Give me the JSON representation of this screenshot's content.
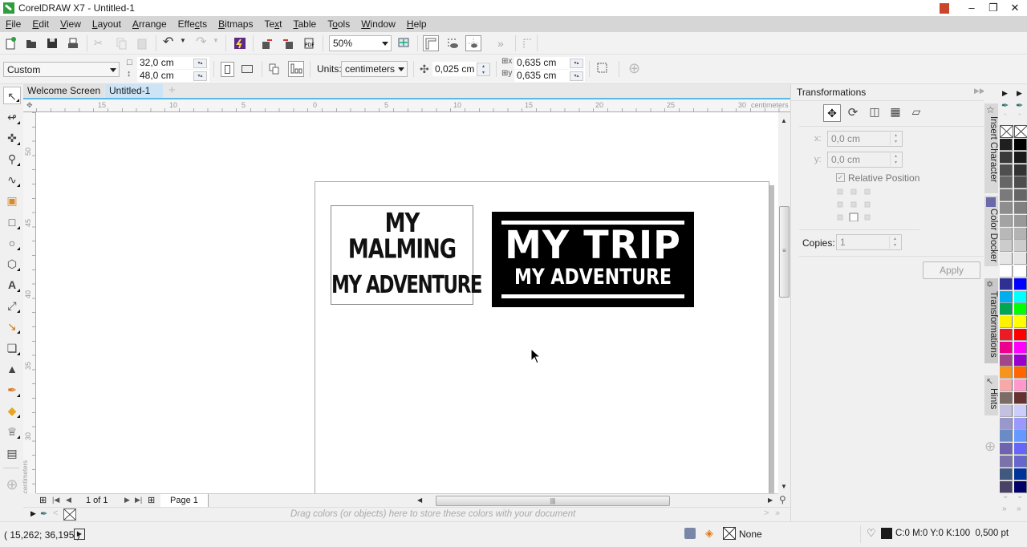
{
  "app": {
    "title": "CorelDRAW X7 - Untitled-1",
    "window_controls": [
      "minimize",
      "restore",
      "close"
    ]
  },
  "menu": [
    {
      "label": "File",
      "mnemonic_index": 0
    },
    {
      "label": "Edit",
      "mnemonic_index": 0
    },
    {
      "label": "View",
      "mnemonic_index": 0
    },
    {
      "label": "Layout",
      "mnemonic_index": 0
    },
    {
      "label": "Arrange",
      "mnemonic_index": 0
    },
    {
      "label": "Effects",
      "mnemonic_index": 4
    },
    {
      "label": "Bitmaps",
      "mnemonic_index": 0
    },
    {
      "label": "Text",
      "mnemonic_index": 2
    },
    {
      "label": "Table",
      "mnemonic_index": 0
    },
    {
      "label": "Tools",
      "mnemonic_index": 1
    },
    {
      "label": "Window",
      "mnemonic_index": 0
    },
    {
      "label": "Help",
      "mnemonic_index": 0
    }
  ],
  "toolbar": {
    "zoom_level": "50%",
    "icons": [
      "new-document",
      "open",
      "save",
      "print",
      "cut",
      "copy",
      "paste",
      "undo",
      "redo",
      "corel-connect",
      "import",
      "export",
      "export-pdf",
      "full-screen-preview",
      "show-rulers",
      "view-grid",
      "snap-to",
      "more",
      "guidelines"
    ]
  },
  "property_bar": {
    "page_size": "Custom",
    "width": "32,0 cm",
    "height": "48,0 cm",
    "units_label": "Units:",
    "units": "centimeters",
    "nudge": "0,025 cm",
    "dup_x": "0,635 cm",
    "dup_y": "0,635 cm"
  },
  "tabs": [
    {
      "label": "Welcome Screen",
      "active": false
    },
    {
      "label": "Untitled-1",
      "active": true
    }
  ],
  "rulers": {
    "h_labels": [
      "15",
      "10",
      "5",
      "0",
      "5",
      "10",
      "15",
      "20",
      "25",
      "30"
    ],
    "h_unit": "centimeters",
    "v_labels": [
      "50",
      "45",
      "40",
      "35",
      "30"
    ],
    "v_unit": "centimeters"
  },
  "canvas": {
    "object1": {
      "line1": "MY MALMING",
      "line2": "MY ADVENTURE"
    },
    "object2": {
      "line1": "MY TRIP",
      "line2": "MY ADVENTURE"
    }
  },
  "page_nav": {
    "count": "1 of 1",
    "page_tab": "Page 1"
  },
  "doc_palette": {
    "hint": "Drag colors (or objects) here to store these colors with your document"
  },
  "status": {
    "coordinates": "( 15,262; 36,195 )",
    "fill": "None",
    "outline": "C:0 M:0 Y:0 K:100  0,500 pt",
    "outline_color": "#1a1a1a"
  },
  "docker": {
    "title": "Transformations",
    "x_label": "x:",
    "x_value": "0,0 cm",
    "y_label": "y:",
    "y_value": "0,0 cm",
    "relative_position": "Relative Position",
    "relative_checked": true,
    "copies_label": "Copies:",
    "copies_value": "1",
    "apply": "Apply"
  },
  "docker_tabs": [
    "Insert Character",
    "Color Docker",
    "Transformations",
    "Hints"
  ],
  "palette": {
    "col1": [
      "#1f1f1f",
      "#3a3a3a",
      "#4f4f4f",
      "#666666",
      "#7a7a7a",
      "#8e8e8e",
      "#a3a3a3",
      "#b8b8b8",
      "#cccccc",
      "#e6e6e6",
      "#ffffff",
      "#2e3192",
      "#00aeef",
      "#00a651",
      "#fff200",
      "#ed1c24",
      "#ec008c",
      "#a3478b",
      "#f7941d",
      "#f9a8a8",
      "#7b6c68",
      "#c4c1e0",
      "#9a97cc",
      "#6a8bc6",
      "#6e63b0",
      "#7a72a8",
      "#41587f",
      "#4a4366"
    ],
    "col2": [
      "#000000",
      "#1a1a1a",
      "#333333",
      "#4d4d4d",
      "#666666",
      "#808080",
      "#999999",
      "#b3b3b3",
      "#cccccc",
      "#e6e6e6",
      "#ffffff",
      "#0000ff",
      "#00ffff",
      "#00ff00",
      "#ffff00",
      "#ff0000",
      "#ff00ff",
      "#9900cc",
      "#ff6600",
      "#ff99cc",
      "#663333",
      "#ccccff",
      "#9999ff",
      "#6699ff",
      "#6666ff",
      "#6666cc",
      "#003399",
      "#000066"
    ]
  }
}
